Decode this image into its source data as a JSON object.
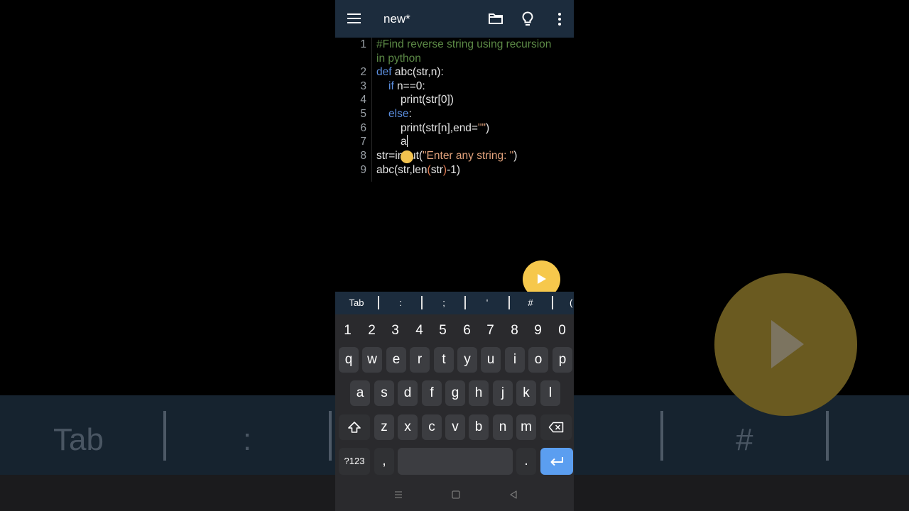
{
  "app": {
    "title": "new*"
  },
  "icons": {
    "menu": "menu-icon",
    "folder": "folder-icon",
    "bulb": "lightbulb-icon",
    "more": "more-vert-icon",
    "run": "play-icon"
  },
  "editor": {
    "line_numbers": [
      "1",
      "2",
      "3",
      "4",
      "5",
      "6",
      "7",
      "8",
      "9"
    ],
    "lines": [
      "#Find reverse string using recursion",
      "in python",
      "def",
      " abc(str,n):",
      "if",
      " n==0:",
      "print(str[0])",
      "else",
      ":",
      "print(str[n],end=",
      "\"\"",
      ")",
      "a",
      "str=input(",
      "\"Enter any string: \"",
      ")",
      "abc(str,len",
      "(",
      "str",
      ")",
      "-1)"
    ]
  },
  "symbol_bar": [
    "Tab",
    ":",
    ";",
    "'",
    "#"
  ],
  "keyboard": {
    "numbers": [
      "1",
      "2",
      "3",
      "4",
      "5",
      "6",
      "7",
      "8",
      "9",
      "0"
    ],
    "row1": [
      "q",
      "w",
      "e",
      "r",
      "t",
      "y",
      "u",
      "i",
      "o",
      "p"
    ],
    "row2": [
      "a",
      "s",
      "d",
      "f",
      "g",
      "h",
      "j",
      "k",
      "l"
    ],
    "row3": [
      "z",
      "x",
      "c",
      "v",
      "b",
      "n",
      "m"
    ],
    "symbols_label": "?123",
    "comma": ",",
    "period": "."
  },
  "background": {
    "tab": "Tab",
    "colon": ":",
    "hash": "#"
  },
  "colors": {
    "appbar": "#1c2c3d",
    "keyword": "#5c8fe0",
    "comment": "#5c8a46",
    "string": "#e3a37c",
    "fab": "#f6c84c",
    "enter_key": "#5b9ef0"
  }
}
